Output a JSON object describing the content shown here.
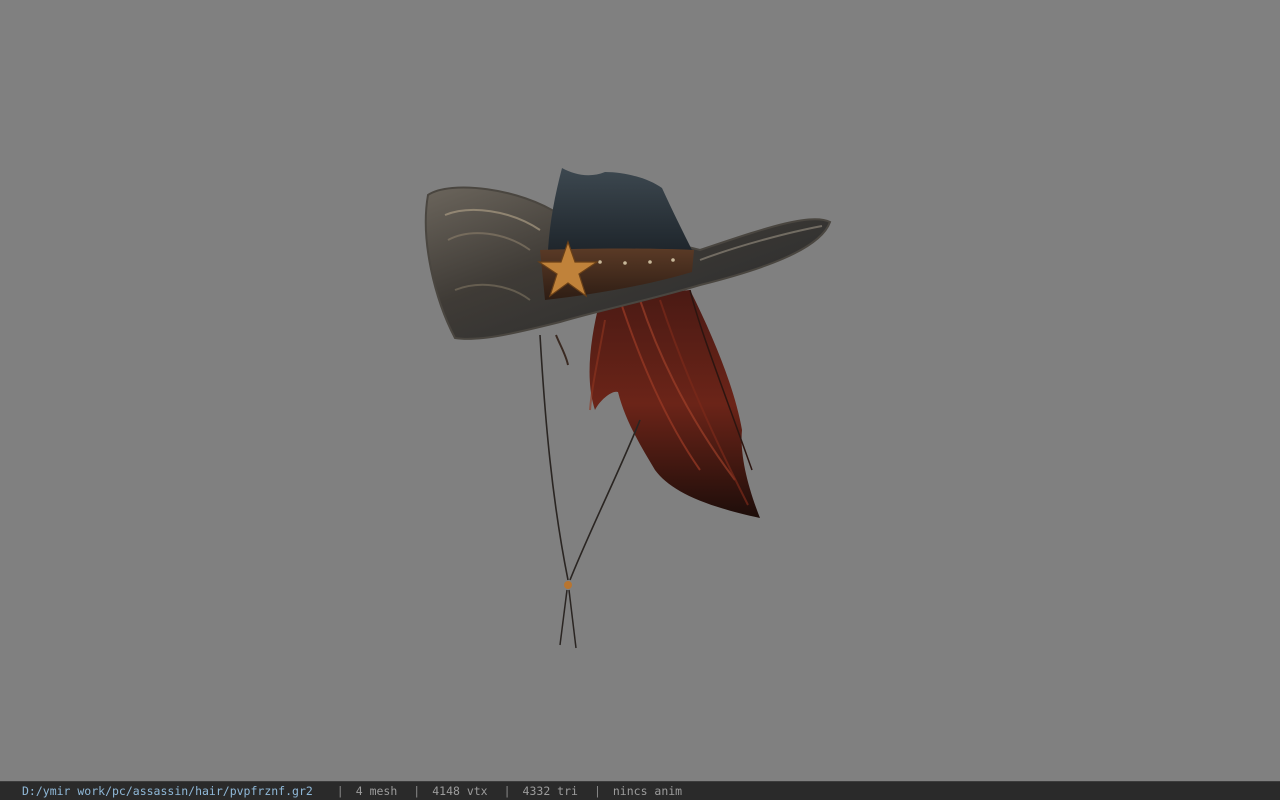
{
  "viewer": {
    "background_color": "#808080",
    "model_name": "cowboy hat with hair"
  },
  "status_bar": {
    "file_path": "D:/ymir work/pc/assassin/hair/pvpfrznf.gr2",
    "separator": "|",
    "mesh_count": "4 mesh",
    "vertex_count": "4148 vtx",
    "triangle_count": "4332 tri",
    "anim_status": "nincs anim",
    "path_color": "#8fb8d8",
    "text_color": "#9c9c9c"
  }
}
